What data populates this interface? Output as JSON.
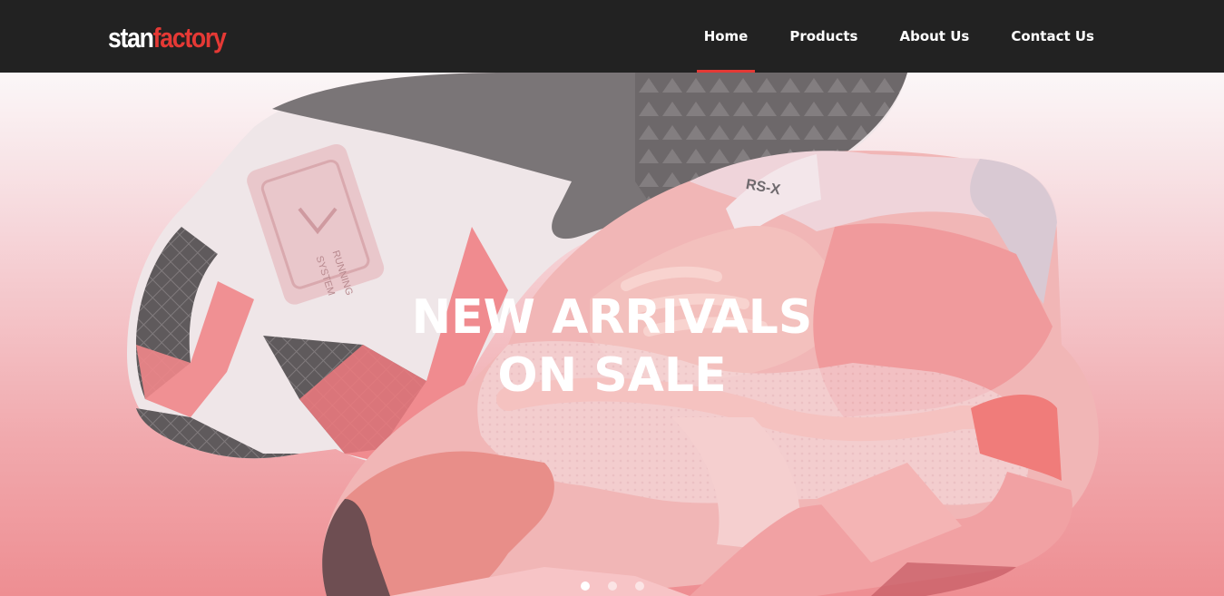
{
  "brand": {
    "part1": "stan",
    "part2": "factory"
  },
  "nav": {
    "items": [
      {
        "label": "Home",
        "active": true
      },
      {
        "label": "Products",
        "active": false
      },
      {
        "label": "About Us",
        "active": false
      },
      {
        "label": "Contact Us",
        "active": false
      }
    ]
  },
  "hero": {
    "headline_line1": "NEW ARRIVALS",
    "headline_line2": "ON SALE",
    "sole_label_line1": "RUNNING",
    "sole_label_line2": "SYSTEM",
    "tongue_label": "RS-X",
    "slides_total": 3,
    "active_slide": 1
  },
  "colors": {
    "navbar_bg": "#222222",
    "accent": "#e53935",
    "text_light": "#ffffff"
  }
}
